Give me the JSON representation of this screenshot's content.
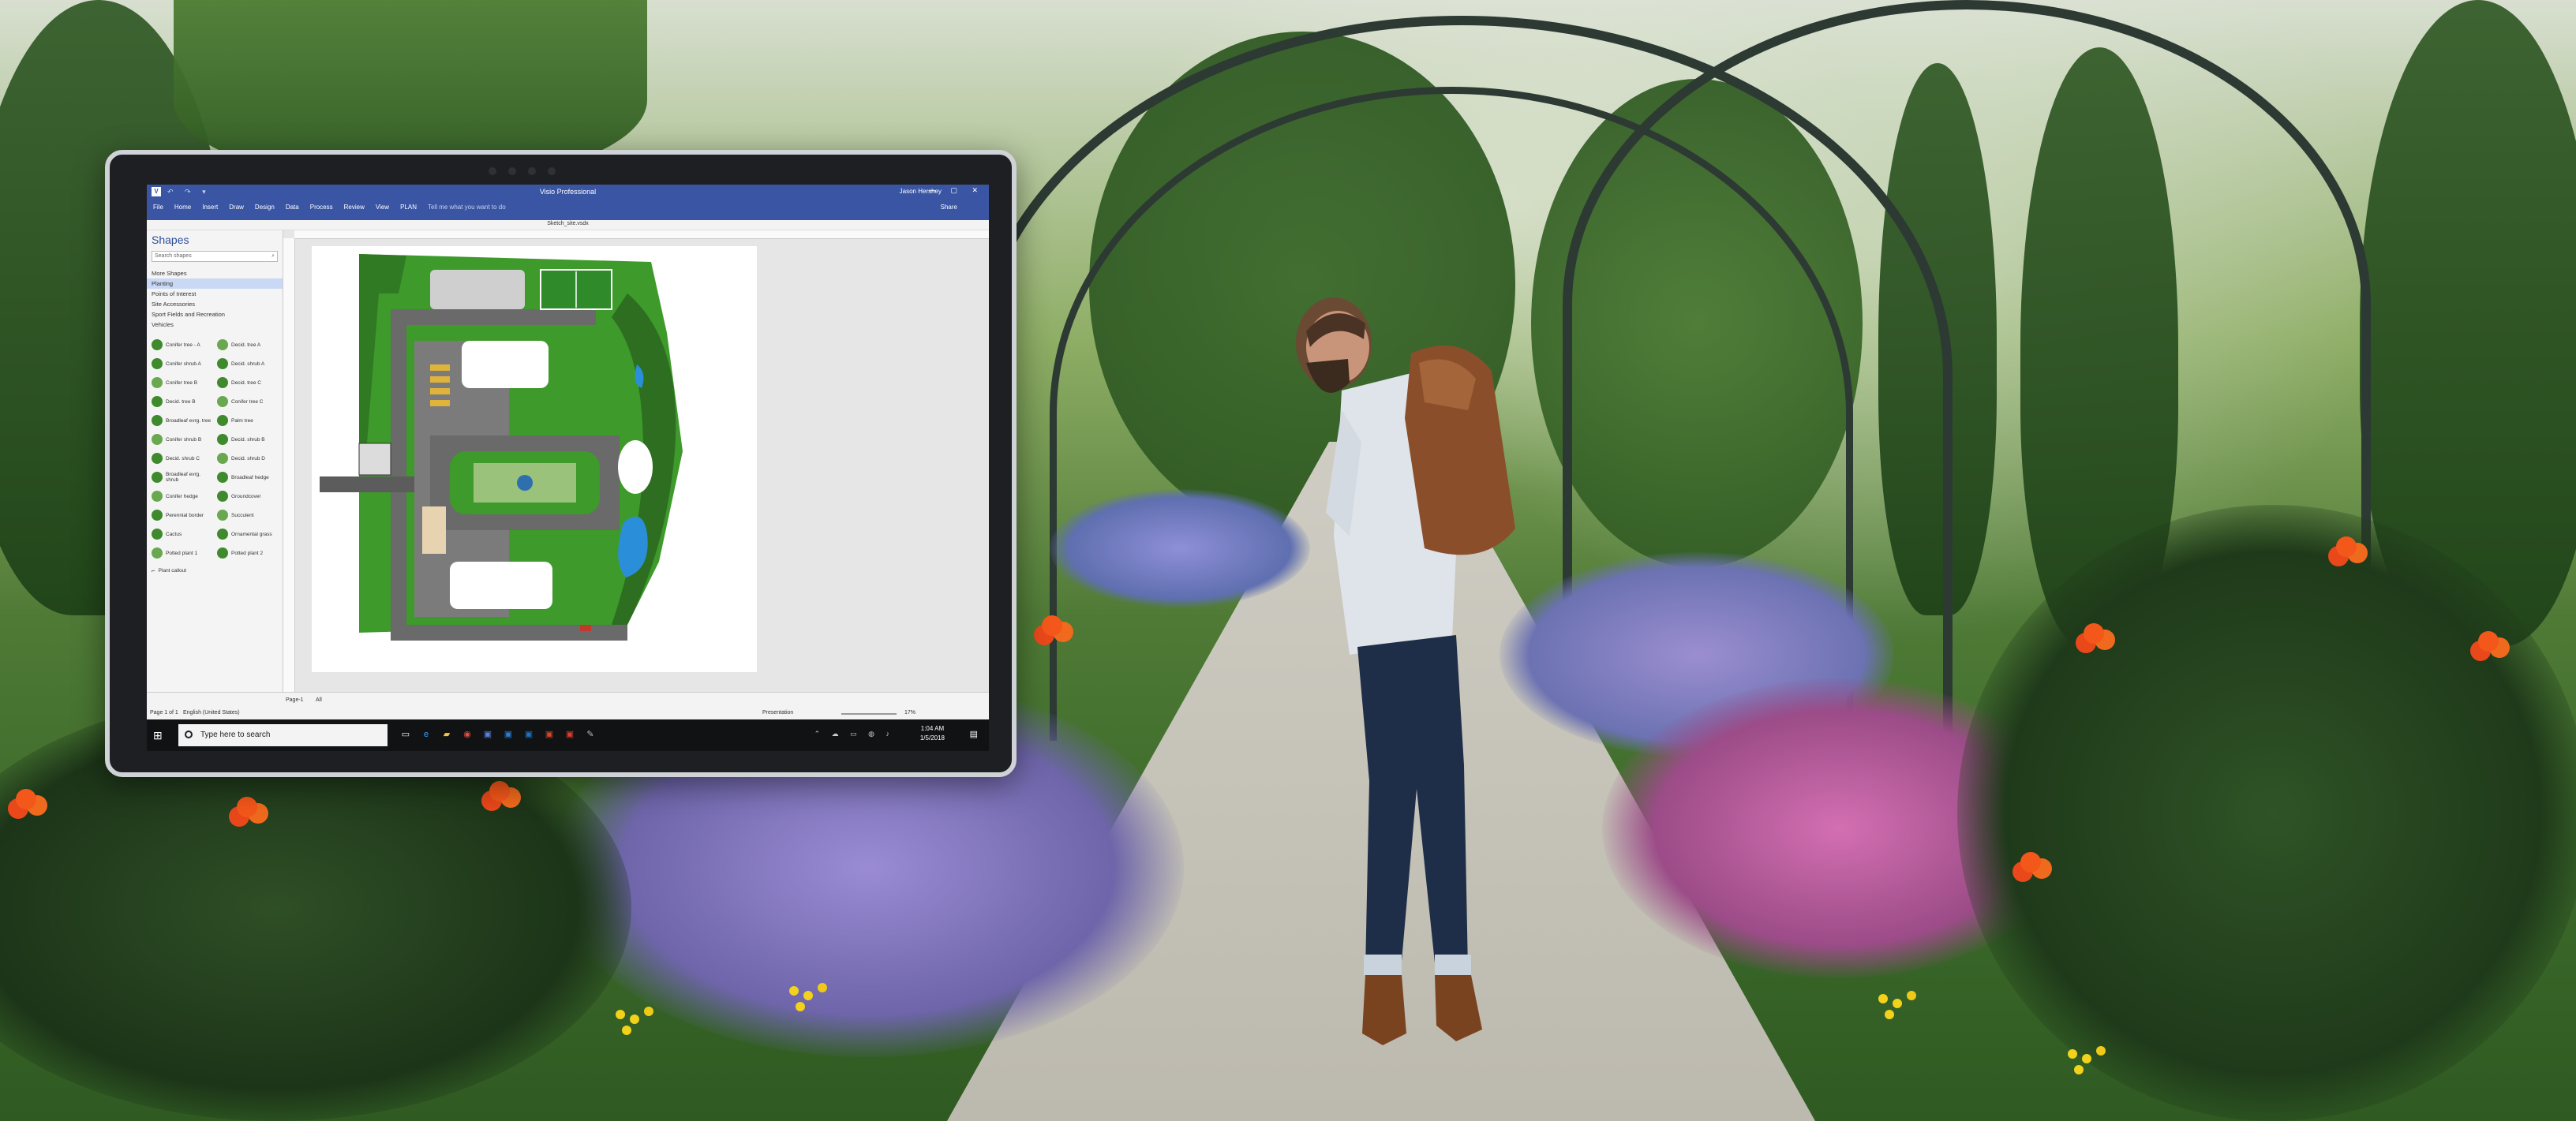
{
  "colors": {
    "ribbon": "#3955a3",
    "taskbar": "#101214",
    "grass": "#3d9a2b",
    "road": "#6a6a6a"
  },
  "app": {
    "title": "Visio Professional",
    "user": "Jason Hershey",
    "app_icon": "V",
    "tabs": [
      "File",
      "Home",
      "Insert",
      "Draw",
      "Design",
      "Data",
      "Process",
      "Review",
      "View",
      "PLAN"
    ],
    "tell_me": "Tell me what you want to do",
    "share": "Share",
    "file_name": "Sketch_site.vsdx"
  },
  "shapes_pane": {
    "title": "Shapes",
    "search_placeholder": "Search shapes",
    "more_shapes": "More Shapes",
    "stencils": [
      "Planting",
      "Points of Interest",
      "Site Accessories",
      "Sport Fields and Recreation",
      "Vehicles"
    ],
    "items": [
      "Conifer tree - A",
      "Decid. tree A",
      "Conifer shrub A",
      "Decid. shrub A",
      "Conifer tree B",
      "Decid. tree C",
      "Decid. tree B",
      "Conifer tree C",
      "Broadleaf evrg. tree",
      "Palm tree",
      "Conifer shrub B",
      "Decid. shrub B",
      "Decid. shrub C",
      "Decid. shrub D",
      "Broadleaf evrg. shrub",
      "Broadleaf hedge",
      "Conifer hedge",
      "Groundcover",
      "Perennial border",
      "Succulent",
      "Cactus",
      "Ornamental grass",
      "Potted plant 1",
      "Potted plant 2"
    ],
    "callout": "Plant callout"
  },
  "status": {
    "page_info": "Page 1 of 1",
    "language": "English (United States)",
    "page_tab": "Page-1",
    "all_tab": "All",
    "presentation": "Presentation",
    "zoom": "17%"
  },
  "taskbar": {
    "search_placeholder": "Type here to search",
    "time": "1:04 AM",
    "date": "1/5/2018"
  }
}
